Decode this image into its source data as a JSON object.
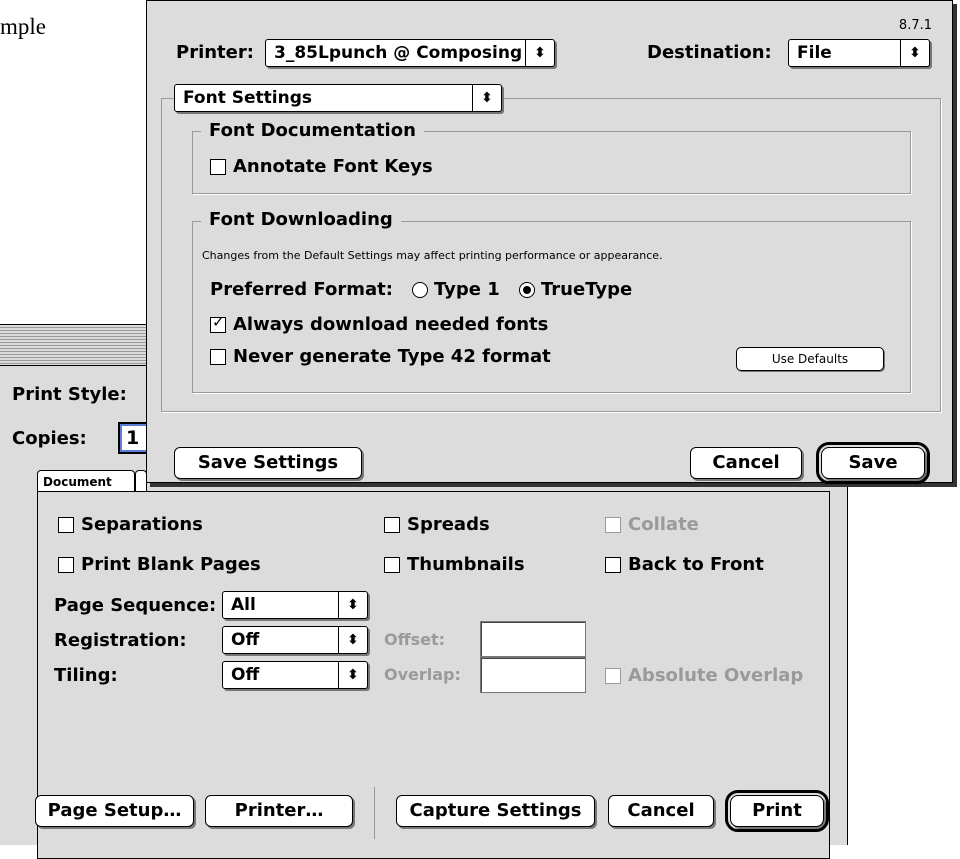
{
  "background": {
    "doc_text": "mple"
  },
  "back_dialog": {
    "print_style_label": "Print Style:",
    "copies_label": "Copies:",
    "copies_value": "1",
    "tabs": [
      "Document",
      ""
    ],
    "document_tab": {
      "separations": "Separations",
      "print_blank_pages": "Print Blank Pages",
      "spreads": "Spreads",
      "thumbnails": "Thumbnails",
      "collate": "Collate",
      "back_to_front": "Back to Front",
      "page_sequence_label": "Page Sequence:",
      "page_sequence_value": "All",
      "registration_label": "Registration:",
      "registration_value": "Off",
      "offset_label": "Offset:",
      "tiling_label": "Tiling:",
      "tiling_value": "Off",
      "overlap_label": "Overlap:",
      "absolute_overlap": "Absolute Overlap"
    },
    "buttons": {
      "page_setup": "Page Setup…",
      "printer": "Printer…",
      "capture_settings": "Capture Settings",
      "cancel": "Cancel",
      "print": "Print"
    }
  },
  "front_dialog": {
    "version": "8.7.1",
    "printer_label": "Printer:",
    "printer_value": "3_85Lpunch @ Composing",
    "destination_label": "Destination:",
    "destination_value": "File",
    "section_popup": "Font Settings",
    "font_documentation": {
      "title": "Font Documentation",
      "annotate_font_keys": "Annotate Font Keys"
    },
    "font_downloading": {
      "title": "Font Downloading",
      "note": "Changes from the Default Settings may affect printing performance or appearance.",
      "preferred_format_label": "Preferred Format:",
      "type1": "Type 1",
      "truetype": "TrueType",
      "preferred_format_selected": "TrueType",
      "always_download": "Always download needed fonts",
      "always_download_checked": true,
      "never_generate": "Never generate Type 42 format",
      "use_defaults": "Use Defaults"
    },
    "buttons": {
      "save_settings": "Save Settings",
      "cancel": "Cancel",
      "save": "Save"
    }
  }
}
